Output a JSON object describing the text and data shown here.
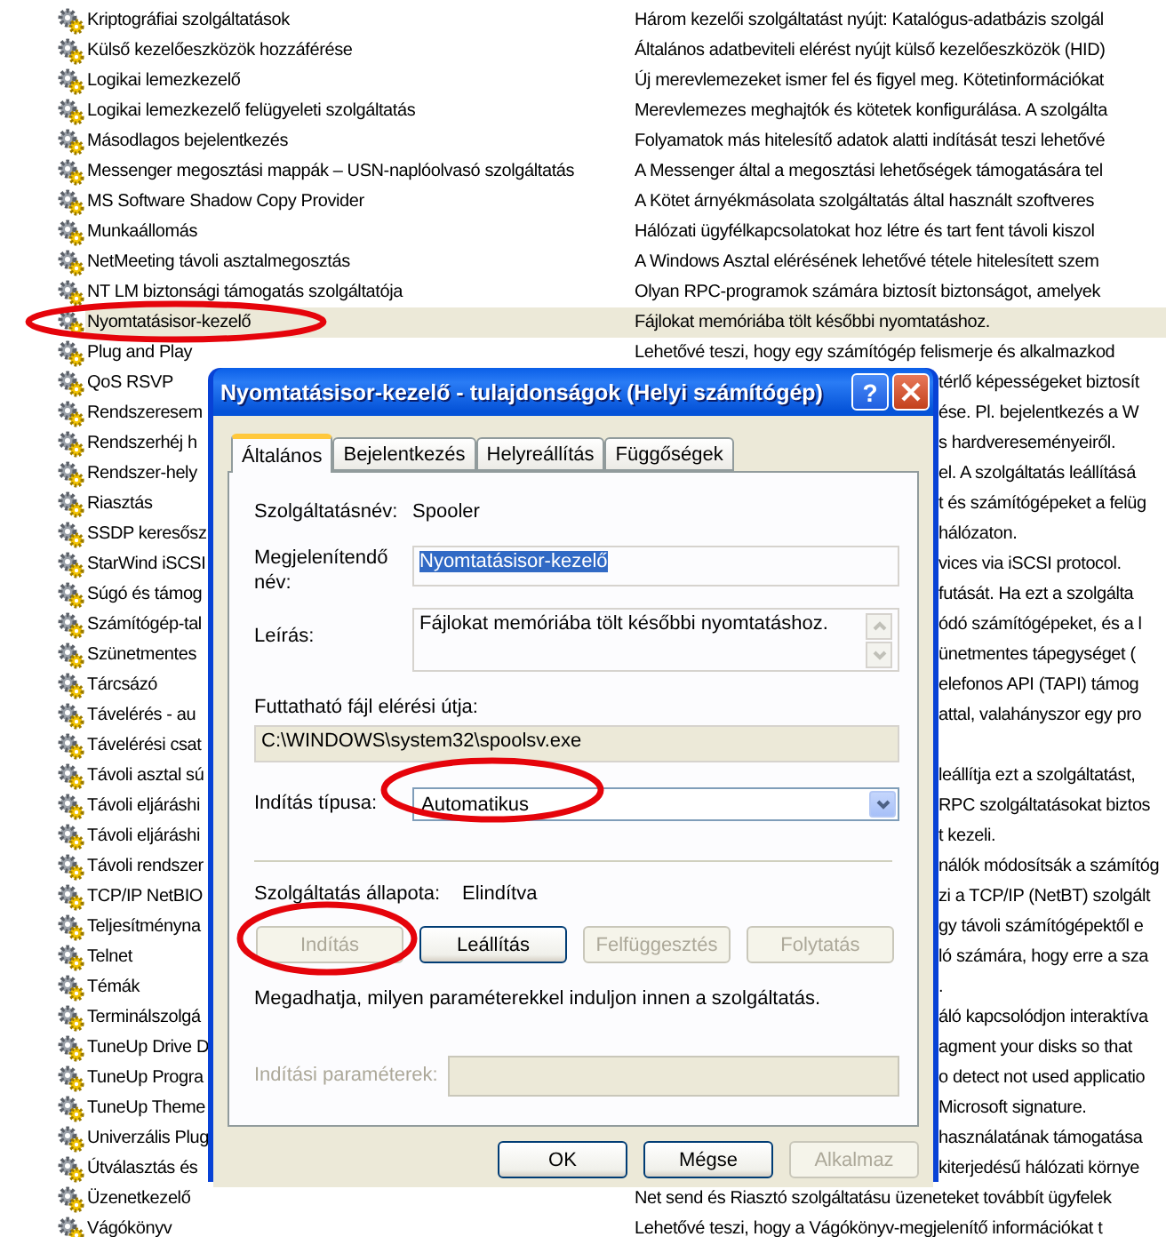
{
  "services": [
    {
      "name": "Kriptográfiai szolgáltatások",
      "description": "Három kezelői szolgáltatást nyújt: Katalógus-adatbázis szolgál",
      "selected": false,
      "kind": "full"
    },
    {
      "name": "Külső kezelőeszközök hozzáférése",
      "description": "Általános adatbeviteli elérést nyújt külső kezelőeszközök (HID)",
      "selected": false,
      "kind": "full"
    },
    {
      "name": "Logikai lemezkezelő",
      "description": "Új merevlemezeket ismer fel és figyel meg. Kötetinformációkat",
      "selected": false,
      "kind": "full"
    },
    {
      "name": "Logikai lemezkezelő felügyeleti szolgáltatás",
      "description": "Merevlemezes meghajtók és kötetek konfigurálása. A szolgálta",
      "selected": false,
      "kind": "full"
    },
    {
      "name": "Másodlagos bejelentkezés",
      "description": "Folyamatok más hitelesítő adatok alatti indítását teszi lehetővé",
      "selected": false,
      "kind": "full"
    },
    {
      "name": "Messenger megosztási mappák – USN-naplóolvasó szolgáltatás",
      "description": "A Messenger által a megosztási lehetőségek támogatására tel",
      "selected": false,
      "kind": "full"
    },
    {
      "name": "MS Software Shadow Copy Provider",
      "description": "A Kötet árnyékmásolata szolgáltatás által használt szoftveres",
      "selected": false,
      "kind": "full"
    },
    {
      "name": "Munkaállomás",
      "description": "Hálózati ügyfélkapcsolatokat hoz létre és tart fent távoli kiszol",
      "selected": false,
      "kind": "full"
    },
    {
      "name": "NetMeeting távoli asztalmegosztás",
      "description": "A Windows Asztal elérésének lehetővé tétele hitelesített szem",
      "selected": false,
      "kind": "full"
    },
    {
      "name": "NT LM biztonsági támogatás szolgáltatója",
      "description": "Olyan RPC-programok számára biztosít biztonságot, amelyek",
      "selected": false,
      "kind": "full"
    },
    {
      "name": "Nyomtatásisor-kezelő",
      "description": "Fájlokat memóriába tölt későbbi nyomtatáshoz.",
      "selected": true,
      "kind": "full"
    },
    {
      "name": "Plug and Play",
      "description": "Lehetővé teszi, hogy egy számítógép felismerje és alkalmazkod",
      "selected": false,
      "kind": "full"
    },
    {
      "name": "QoS RSVP",
      "description": "térlő képességeket biztosít",
      "selected": false,
      "kind": "partly-hidden"
    },
    {
      "name": "Rendszeresem",
      "description": "ése. Pl. bejelentkezés a W",
      "selected": false,
      "kind": "partly-hidden"
    },
    {
      "name": "Rendszerhéj h",
      "description": "s hardvereseményeiről.",
      "selected": false,
      "kind": "partly-hidden"
    },
    {
      "name": "Rendszer-hely",
      "description": "el. A szolgáltatás leállításá",
      "selected": false,
      "kind": "partly-hidden"
    },
    {
      "name": "Riasztás",
      "description": "t és számítógépeket a felüg",
      "selected": false,
      "kind": "partly-hidden"
    },
    {
      "name": "SSDP keresősz",
      "description": "hálózaton.",
      "selected": false,
      "kind": "partly-hidden"
    },
    {
      "name": "StarWind iSCSI",
      "description": "vices via iSCSI protocol.",
      "selected": false,
      "kind": "partly-hidden"
    },
    {
      "name": "Súgó és támog",
      "description": "futását. Ha ezt a szolgálta",
      "selected": false,
      "kind": "partly-hidden"
    },
    {
      "name": "Számítógép-tal",
      "description": "ódó számítógépeket, és a l",
      "selected": false,
      "kind": "partly-hidden"
    },
    {
      "name": "Szünetmentes",
      "description": "ünetmentes tápegységet (",
      "selected": false,
      "kind": "partly-hidden"
    },
    {
      "name": "Tárcsázó",
      "description": "elefonos API (TAPI) támog",
      "selected": false,
      "kind": "partly-hidden"
    },
    {
      "name": "Távelérés - au",
      "description": "attal, valahányszor egy pro",
      "selected": false,
      "kind": "partly-hidden"
    },
    {
      "name": "Távelérési csat",
      "selected": false,
      "kind": "partly-hidden"
    },
    {
      "name": "Távoli asztal sú",
      "description": "leállítja ezt a szolgáltatást,",
      "selected": false,
      "kind": "partly-hidden"
    },
    {
      "name": "Távoli eljáráshi",
      "description": "RPC szolgáltatásokat biztos",
      "selected": false,
      "kind": "partly-hidden"
    },
    {
      "name": "Távoli eljáráshi",
      "description": "t kezeli.",
      "selected": false,
      "kind": "partly-hidden"
    },
    {
      "name": "Távoli rendszer",
      "description": "nálók módosítsák a számítóg",
      "selected": false,
      "kind": "partly-hidden"
    },
    {
      "name": "TCP/IP NetBIO",
      "description": "zi a TCP/IP (NetBT) szolgált",
      "selected": false,
      "kind": "partly-hidden"
    },
    {
      "name": "Teljesítményna",
      "description": "gy távoli számítógépektől e",
      "selected": false,
      "kind": "partly-hidden"
    },
    {
      "name": "Telnet",
      "description": "ló számára, hogy erre a sza",
      "selected": false,
      "kind": "partly-hidden"
    },
    {
      "name": "Témák",
      "description": ".",
      "selected": false,
      "kind": "partly-hidden"
    },
    {
      "name": "Terminálszolgá",
      "description": "áló kapcsolódjon interaktíva",
      "selected": false,
      "kind": "partly-hidden"
    },
    {
      "name": "TuneUp Drive D",
      "description": "agment your disks so that",
      "selected": false,
      "kind": "partly-hidden"
    },
    {
      "name": "TuneUp Progra",
      "description": "o detect not used applicatio",
      "selected": false,
      "kind": "partly-hidden"
    },
    {
      "name": "TuneUp Theme",
      "description": "Microsoft signature.",
      "selected": false,
      "kind": "partly-hidden"
    },
    {
      "name": "Univerzális Plug",
      "description": "használatának támogatása",
      "selected": false,
      "kind": "partly-hidden"
    },
    {
      "name": "Útválasztás és",
      "description": "kiterjedésű hálózati környe",
      "selected": false,
      "kind": "partly-hidden"
    },
    {
      "name": "Üzenetkezelő",
      "description": "Net send és Riasztó szolgáltatásu üzeneteket továbbít ügyfelek",
      "selected": false,
      "kind": "full"
    },
    {
      "name": "Vágókönyv",
      "description": "Lehetővé teszi, hogy a Vágókönyv-megjelenítő információkat t",
      "selected": false,
      "kind": "full"
    }
  ],
  "dialog": {
    "title": "Nyomtatásisor-kezelő - tulajdonságok (Helyi számítógép)",
    "help_button": "?",
    "tabs": [
      {
        "label": "Általános",
        "selected": true
      },
      {
        "label": "Bejelentkezés",
        "selected": false
      },
      {
        "label": "Helyreállítás",
        "selected": false
      },
      {
        "label": "Függőségek",
        "selected": false
      }
    ],
    "service_name": {
      "label": "Szolgáltatásnév:",
      "value": "Spooler"
    },
    "display_name": {
      "label": "Megjelenítendő név:",
      "value": "Nyomtatásisor-kezelő"
    },
    "description": {
      "label": "Leírás:",
      "value": "Fájlokat memóriába tölt későbbi nyomtatáshoz."
    },
    "executable_path": {
      "label": "Futtatható fájl elérési útja:",
      "value": "C:\\WINDOWS\\system32\\spoolsv.exe"
    },
    "startup_type": {
      "label": "Indítás típusa:",
      "value": "Automatikus"
    },
    "service_status": {
      "label": "Szolgáltatás állapota:",
      "value": "Elindítva"
    },
    "control_buttons": [
      {
        "label": "Indítás",
        "disabled": true
      },
      {
        "label": "Leállítás",
        "disabled": false
      },
      {
        "label": "Felfüggesztés",
        "disabled": true
      },
      {
        "label": "Folytatás",
        "disabled": true
      }
    ],
    "hint": "Megadhatja, milyen paraméterekkel induljon innen a szolgáltatás.",
    "start_parameters": {
      "label": "Indítási paraméterek:",
      "disabled": true
    },
    "footer_buttons": [
      {
        "label": "OK",
        "disabled": false
      },
      {
        "label": "Mégse",
        "disabled": false
      },
      {
        "label": "Alkalmaz",
        "disabled": true
      }
    ]
  }
}
